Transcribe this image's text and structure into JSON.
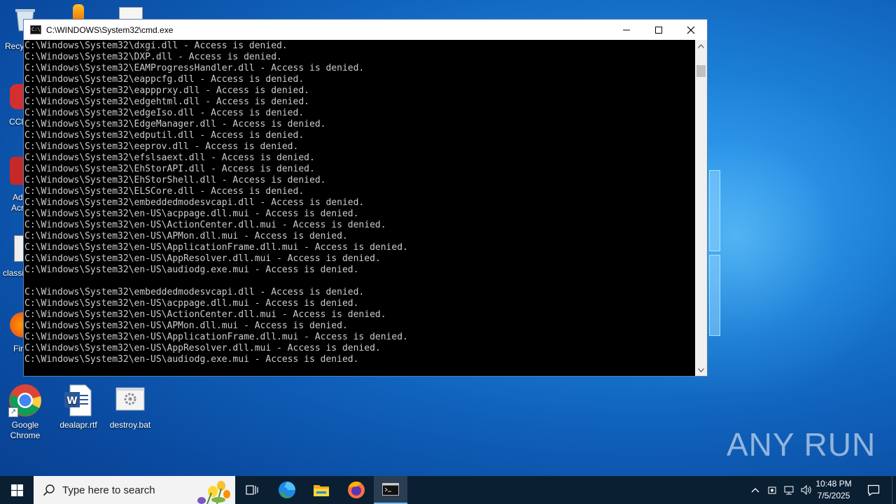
{
  "window": {
    "title": "C:\\WINDOWS\\System32\\cmd.exe",
    "icon": "cmd-icon",
    "buttons": [
      "minimize-icon",
      "maximize-icon",
      "close-icon"
    ]
  },
  "console_lines": [
    "C:\\Windows\\System32\\dxgi.dll - Access is denied.",
    "C:\\Windows\\System32\\DXP.dll - Access is denied.",
    "C:\\Windows\\System32\\EAMProgressHandler.dll - Access is denied.",
    "C:\\Windows\\System32\\eappcfg.dll - Access is denied.",
    "C:\\Windows\\System32\\eappprxy.dll - Access is denied.",
    "C:\\Windows\\System32\\edgehtml.dll - Access is denied.",
    "C:\\Windows\\System32\\edgeIso.dll - Access is denied.",
    "C:\\Windows\\System32\\EdgeManager.dll - Access is denied.",
    "C:\\Windows\\System32\\edputil.dll - Access is denied.",
    "C:\\Windows\\System32\\eeprov.dll - Access is denied.",
    "C:\\Windows\\System32\\efslsaext.dll - Access is denied.",
    "C:\\Windows\\System32\\EhStorAPI.dll - Access is denied.",
    "C:\\Windows\\System32\\EhStorShell.dll - Access is denied.",
    "C:\\Windows\\System32\\ELSCore.dll - Access is denied.",
    "C:\\Windows\\System32\\embeddedmodesvcapi.dll - Access is denied.",
    "C:\\Windows\\System32\\en-US\\acppage.dll.mui - Access is denied.",
    "C:\\Windows\\System32\\en-US\\ActionCenter.dll.mui - Access is denied.",
    "C:\\Windows\\System32\\en-US\\APMon.dll.mui - Access is denied.",
    "C:\\Windows\\System32\\en-US\\ApplicationFrame.dll.mui - Access is denied.",
    "C:\\Windows\\System32\\en-US\\AppResolver.dll.mui - Access is denied.",
    "C:\\Windows\\System32\\en-US\\audiodg.exe.mui - Access is denied.",
    "",
    "C:\\Windows\\System32\\embeddedmodesvcapi.dll - Access is denied.",
    "C:\\Windows\\System32\\en-US\\acppage.dll.mui - Access is denied.",
    "C:\\Windows\\System32\\en-US\\ActionCenter.dll.mui - Access is denied.",
    "C:\\Windows\\System32\\en-US\\APMon.dll.mui - Access is denied.",
    "C:\\Windows\\System32\\en-US\\ApplicationFrame.dll.mui - Access is denied.",
    "C:\\Windows\\System32\\en-US\\AppResolver.dll.mui - Access is denied.",
    "C:\\Windows\\System32\\en-US\\audiodg.exe.mui - Access is denied."
  ],
  "desktop": {
    "partial_labels": [
      "Recy",
      "CCl",
      "Ad",
      "Acr",
      "classi",
      "Fir"
    ],
    "icons": [
      {
        "label_line1": "Google",
        "label_line2": "Chrome",
        "icon": "chrome-icon"
      },
      {
        "label_line1": "dealapr.rtf",
        "label_line2": "",
        "icon": "word-document-icon"
      },
      {
        "label_line1": "destroy.bat",
        "label_line2": "",
        "icon": "batch-file-icon"
      }
    ]
  },
  "watermark": "ANY RUN",
  "taskbar": {
    "search_placeholder": "Type here to search",
    "clock_time": "10:48 PM",
    "clock_date": "7/5/2025"
  },
  "colors": {
    "console_bg": "#000000",
    "console_text": "#cccccc",
    "taskbar_bg": "#0b1f33"
  }
}
